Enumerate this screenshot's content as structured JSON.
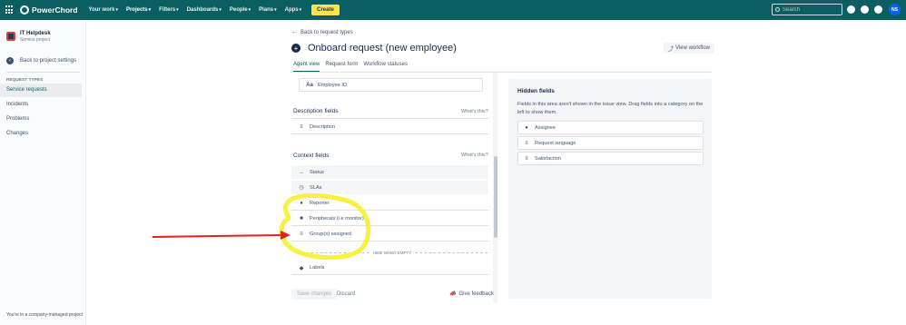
{
  "topbar": {
    "brand": "PowerChord",
    "nav": [
      {
        "label": "Your work",
        "caret": "▾"
      },
      {
        "label": "Projects",
        "caret": "▾"
      },
      {
        "label": "Filters",
        "caret": "▾"
      },
      {
        "label": "Dashboards",
        "caret": "▾"
      },
      {
        "label": "People",
        "caret": "▾"
      },
      {
        "label": "Plans",
        "caret": "▾"
      },
      {
        "label": "Apps",
        "caret": "▾"
      }
    ],
    "create": "Create",
    "search_placeholder": "Search",
    "avatar": "NS",
    "icons": [
      "notifications-icon",
      "help-icon",
      "settings-icon"
    ]
  },
  "sidebar": {
    "project_name": "IT Helpdesk",
    "project_type": "Service project",
    "back_settings": "Back to project settings",
    "section": "REQUEST TYPES",
    "items": [
      "Service requests",
      "Incidents",
      "Problems",
      "Changes"
    ],
    "footer": "You're in a company-managed project"
  },
  "main": {
    "back_link": "Back to request types",
    "title": "Onboard request (new employee)",
    "view_workflow": "View workflow",
    "tabs": [
      "Agent view",
      "Request form",
      "Workflow statuses"
    ],
    "employee_field": {
      "icon": "Aa",
      "label": "Employee ID"
    },
    "description_section": "Description fields",
    "whats_this": "What's this?",
    "description_fields": [
      {
        "icon": "≡",
        "label": "Description"
      }
    ],
    "context_section": "Context fields",
    "context_fields": [
      {
        "icon": "→",
        "label": "Status"
      },
      {
        "icon": "◷",
        "label": "SLAs"
      },
      {
        "icon": "●",
        "label": "Reporter"
      },
      {
        "icon": "■",
        "label": "Peripherals (i.e monitor)"
      },
      {
        "icon": "≡",
        "label": "Group(s) assigned"
      }
    ],
    "hide_when_empty": "HIDE WHEN EMPTY",
    "extra_fields": [
      {
        "icon": "◆",
        "label": "Labels"
      }
    ],
    "save": "Save changes",
    "discard": "Discard",
    "give_feedback": "Give feedback"
  },
  "hidden_panel": {
    "title": "Hidden fields",
    "description": "Fields in this area aren't shown in the issue view. Drag fields into a category on the left to show them.",
    "fields": [
      {
        "icon": "●",
        "label": "Assignee"
      },
      {
        "icon": "≡",
        "label": "Request language"
      },
      {
        "icon": "≡",
        "label": "Satisfaction"
      }
    ]
  },
  "colors": {
    "topbar": "#0b5f61",
    "create": "#ffe24a",
    "annotation_highlight": "#f7ef2a",
    "annotation_arrow": "#e8201c"
  }
}
